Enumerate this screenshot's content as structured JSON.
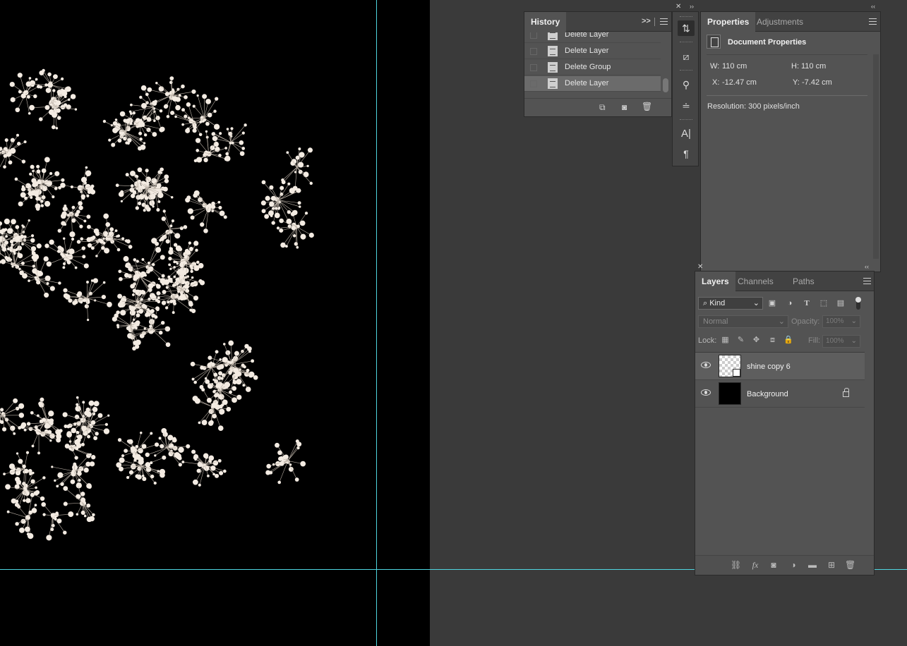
{
  "history": {
    "tab": "History",
    "expand": ">>",
    "items": [
      {
        "label": "Delete Layer"
      },
      {
        "label": "Delete Layer"
      },
      {
        "label": "Delete Group"
      },
      {
        "label": "Delete Layer"
      }
    ],
    "selected_index": 3
  },
  "properties": {
    "tabs": [
      "Properties",
      "Adjustments"
    ],
    "heading": "Document Properties",
    "w_label": "W:",
    "w_value": "110 cm",
    "h_label": "H:",
    "h_value": "110 cm",
    "x_label": "X:",
    "x_value": "-12.47 cm",
    "y_label": "Y:",
    "y_value": "-7.42 cm",
    "resolution": "Resolution: 300 pixels/inch"
  },
  "layers": {
    "tabs": [
      "Layers",
      "Channels",
      "Paths"
    ],
    "filter_kind": "Kind",
    "blend_mode": "Normal",
    "opacity_label": "Opacity:",
    "opacity_value": "100%",
    "lock_label": "Lock:",
    "fill_label": "Fill:",
    "fill_value": "100%",
    "items": [
      {
        "name": "shine copy 6",
        "visible": true,
        "selected": true,
        "type": "smart-object"
      },
      {
        "name": "Background",
        "visible": true,
        "selected": false,
        "locked": true
      }
    ]
  },
  "colors": {
    "guide": "#4fd6e0",
    "canvas": "#000000",
    "flower": "#f3ebe2"
  }
}
